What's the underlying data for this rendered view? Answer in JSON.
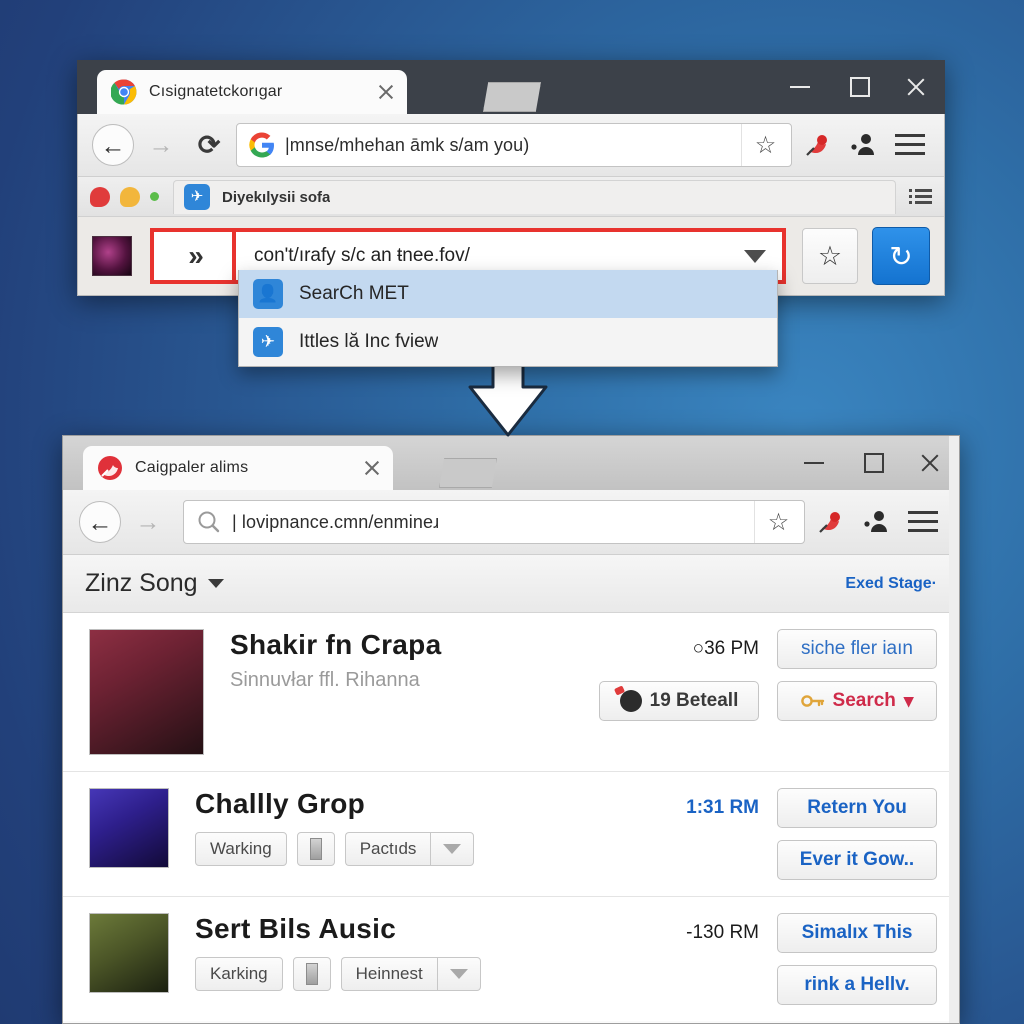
{
  "background": {
    "color_light": "#3a85c0",
    "color_dark": "#1d3569"
  },
  "top_window": {
    "tab": {
      "title": "Cısignatetckorıgar",
      "favicon": "chrome-logo-icon",
      "close": "✕"
    },
    "window_controls": {
      "minimize": "–",
      "maximize": "□",
      "close": "✕"
    },
    "toolbar": {
      "back": "←",
      "forward": "→",
      "reload": "⟳",
      "omnibox_icon": "google-g-icon",
      "omnibox_value": "|mnse/mhehan āmk s/am you)",
      "bookmark_star": "☆",
      "ext_badge_icon": "red-extension-icon",
      "ext_profile_icon": "profile-extension-icon",
      "menu": "hamburger-menu-icon"
    },
    "bookmark_bar": {
      "balloon_red": "#e03b3b",
      "balloon_orange": "#f2b63c",
      "green_dot": "#5bbd4a",
      "page_chip_label": "Diyekılysii sofa",
      "page_chip_icon": "blue-app-icon",
      "list_icon": "list-view-icon"
    },
    "action_row": {
      "thumbnail": "dark-media-thumbnail",
      "chevron_button": "»",
      "url_value": "con't/ırafy s/c an ŧnee.fov/",
      "dropdown_caret": "▼",
      "star_button": "☆",
      "sync_button": "↻",
      "highlight_color": "#e8332e"
    },
    "suggestions": [
      {
        "icon": "person-icon",
        "label": "SearCh MET",
        "selected": true
      },
      {
        "icon": "plane-icon",
        "label": "Ittles lă Inc fview",
        "selected": false
      }
    ]
  },
  "arrow": {
    "name": "down-arrow",
    "glyph": "↓"
  },
  "bottom_window": {
    "tab": {
      "title": "Caigpaler alims",
      "favicon": "red-app-icon",
      "close": "✕"
    },
    "window_controls": {
      "minimize": "–",
      "maximize": "□",
      "close": "✕"
    },
    "toolbar": {
      "back": "←",
      "forward": "→",
      "omnibox_icon": "search-icon",
      "omnibox_value": "| lovipnance.cmn/enmineɹ",
      "bookmark_star": "☆",
      "ext_badge_icon": "red-extension-icon",
      "ext_profile_icon": "profile-extension-icon",
      "menu": "hamburger-menu-icon"
    },
    "appbar": {
      "title": "Zinz Song",
      "caret": "▾",
      "link": "Exed Stage·"
    },
    "rows": [
      {
        "avatar": "portrait-curly-hair",
        "name": "Shakir fn Crapa",
        "subtitle": "Sinnuvłar ffl. Rihanna",
        "time": "○36 PM",
        "primary_button": "siche fler iaın",
        "secondary_button": "19 Beteall",
        "secondary_icon": "bomb-icon",
        "tertiary_button": "Search",
        "tertiary_icon": "key-icon",
        "tertiary_caret": "▾"
      },
      {
        "avatar": "portrait-blue-stage",
        "name": "Challly  Grop",
        "chips": [
          "Warking",
          "Pactıds"
        ],
        "chip_icon": "door-icon",
        "chip_caret": "▼",
        "time": "1:31 RM",
        "primary_button": "Retern You",
        "secondary_button": "Ever it Gow.."
      },
      {
        "avatar": "portrait-green-outdoor",
        "name": "Sert Bils  Ausic",
        "chips": [
          "Κarking",
          "Heinnest"
        ],
        "chip_icon": "door-icon",
        "chip_caret": "▼",
        "time": "-130 RM",
        "primary_button": "Simalıx This",
        "secondary_button": "rink a Hellv."
      }
    ]
  }
}
